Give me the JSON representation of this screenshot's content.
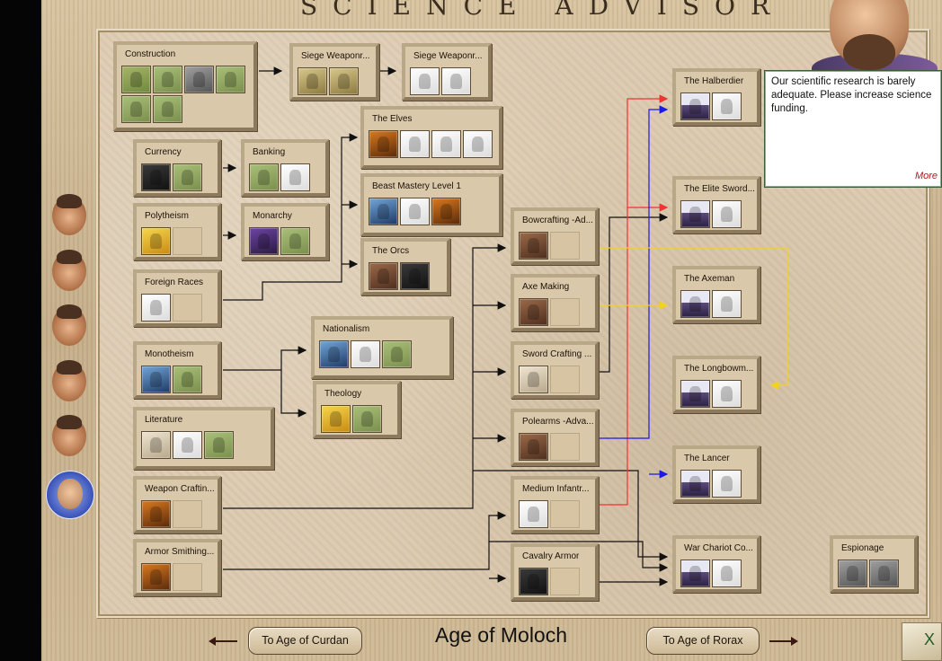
{
  "window": {
    "title": "SCIENCE ADVISOR"
  },
  "advisor_message": {
    "text": "Our scientific research is barely adequate. Please increase science funding.",
    "more": "More"
  },
  "advisors": [
    {
      "name": "advisor-1"
    },
    {
      "name": "advisor-2"
    },
    {
      "name": "advisor-3"
    },
    {
      "name": "advisor-4"
    },
    {
      "name": "advisor-5"
    },
    {
      "name": "advisor-science"
    }
  ],
  "footer": {
    "age_title": "Age of Moloch",
    "prev_age": "To Age of Curdan",
    "next_age": "To Age of Rorax",
    "close": "X"
  },
  "tech_tree": [
    {
      "id": "construction",
      "label": "Construction",
      "icons": [
        "road-icon",
        "colosseum-icon",
        "tower-icon",
        "map-icon",
        "temple-icon",
        "house-icon"
      ]
    },
    {
      "id": "siege1",
      "label": "Siege Weaponr...",
      "icons": [
        "catapult-icon",
        "catapult-icon"
      ]
    },
    {
      "id": "siege2",
      "label": "Siege Weaponr...",
      "icons": [
        "ballista-icon",
        "siege-tower-icon"
      ]
    },
    {
      "id": "currency",
      "label": "Currency",
      "icons": [
        "coins-icon",
        "market-icon"
      ]
    },
    {
      "id": "banking",
      "label": "Banking",
      "icons": [
        "bank-icon",
        "building-icon"
      ]
    },
    {
      "id": "polytheism",
      "label": "Polytheism",
      "icons": [
        "candle-icon"
      ]
    },
    {
      "id": "monarchy",
      "label": "Monarchy",
      "icons": [
        "crown-icon",
        "castle-icon"
      ]
    },
    {
      "id": "foreign_races",
      "label": "Foreign Races",
      "icons": [
        "foreigner-icon"
      ]
    },
    {
      "id": "elves",
      "label": "The Elves",
      "icons": [
        "fire-icon",
        "elf-warrior-icon",
        "elf-archer-icon",
        "elf-knight-icon"
      ]
    },
    {
      "id": "beast",
      "label": "Beast Mastery Level 1",
      "icons": [
        "mountain-icon",
        "beast-icon",
        "fire-icon"
      ]
    },
    {
      "id": "orcs",
      "label": "The Orcs",
      "icons": [
        "orc-icon",
        "orc-warrior-icon"
      ]
    },
    {
      "id": "monotheism",
      "label": "Monotheism",
      "icons": [
        "eye-icon",
        "church-icon"
      ]
    },
    {
      "id": "nationalism",
      "label": "Nationalism",
      "icons": [
        "flag-icon",
        "fort-icon",
        "scroll-icon"
      ]
    },
    {
      "id": "theology",
      "label": "Theology",
      "icons": [
        "buddha-icon",
        "shrine-icon"
      ]
    },
    {
      "id": "literature",
      "label": "Literature",
      "icons": [
        "book-icon",
        "library-icon",
        "school-icon"
      ]
    },
    {
      "id": "weapon",
      "label": "Weapon Craftin...",
      "icons": [
        "forge-icon"
      ]
    },
    {
      "id": "armor",
      "label": "Armor Smithing...",
      "icons": [
        "anvil-icon"
      ]
    },
    {
      "id": "bow",
      "label": "Bowcrafting -Ad...",
      "icons": [
        "bow-icon"
      ]
    },
    {
      "id": "axe",
      "label": "Axe Making",
      "icons": [
        "axe-icon"
      ]
    },
    {
      "id": "sword",
      "label": "Sword Crafting ...",
      "icons": [
        "sword-icon"
      ]
    },
    {
      "id": "polearms",
      "label": "Polearms -Adva...",
      "icons": [
        "polearm-icon"
      ]
    },
    {
      "id": "medium",
      "label": "Medium Infantr...",
      "icons": [
        "chainmail-icon"
      ]
    },
    {
      "id": "cavalry",
      "label": "Cavalry Armor",
      "icons": [
        "horse-armor-icon"
      ]
    },
    {
      "id": "halberdier",
      "label": "The Halberdier",
      "icons": [
        "army-icon",
        "halberdier-icon"
      ]
    },
    {
      "id": "elite",
      "label": "The Elite Sword...",
      "icons": [
        "army-icon",
        "swordsman-icon"
      ]
    },
    {
      "id": "axeman",
      "label": "The Axeman",
      "icons": [
        "army-icon",
        "axeman-icon"
      ]
    },
    {
      "id": "longbow",
      "label": "The Longbowm...",
      "icons": [
        "army-icon",
        "longbowman-icon"
      ]
    },
    {
      "id": "lancer",
      "label": "The Lancer",
      "icons": [
        "army-icon",
        "lancer-icon"
      ]
    },
    {
      "id": "chariot",
      "label": "War Chariot Co...",
      "icons": [
        "army-icon",
        "chariot-icon"
      ]
    },
    {
      "id": "espionage",
      "label": "Espionage",
      "icons": [
        "spy-icon",
        "tower-icon"
      ]
    }
  ]
}
